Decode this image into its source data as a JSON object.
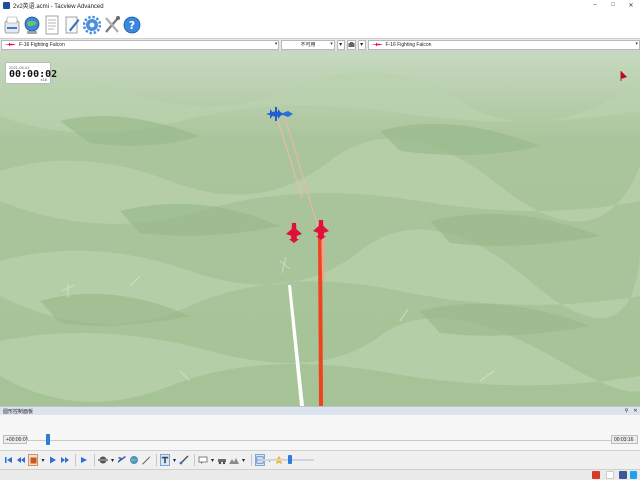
{
  "window": {
    "title": "2v2英语.acmi - Tacview Advanced",
    "minimize": "–",
    "maximize": "□",
    "close": "✕"
  },
  "toolbar": {
    "items": [
      "open-icon",
      "globe-icon",
      "document-icon",
      "edit-icon",
      "gear-icon",
      "tools-icon",
      "help-icon"
    ]
  },
  "selector_bar": {
    "left_object": "F-16 Fighting Falcon",
    "middle_label": "不可用",
    "right_object": "F-16 Fighting Falcon",
    "dropdown_glyph": "▾"
  },
  "viewport": {
    "clock_date": "2021-05-01",
    "clock_time": "00:00:02",
    "clock_rate": "x16",
    "colors": {
      "terrain": "#a9c59b",
      "blue_coalition": "#1f5fd0",
      "red_coalition": "#e0103a",
      "trail_red": "#f0431c",
      "trail_white": "#ffffff"
    }
  },
  "bottom_panel": {
    "title": "圆形控制面板",
    "start_time": "+00:00:01",
    "end_time": "00:03:16",
    "progress": 0.02
  },
  "playback": {
    "speed_level": 0.5
  }
}
